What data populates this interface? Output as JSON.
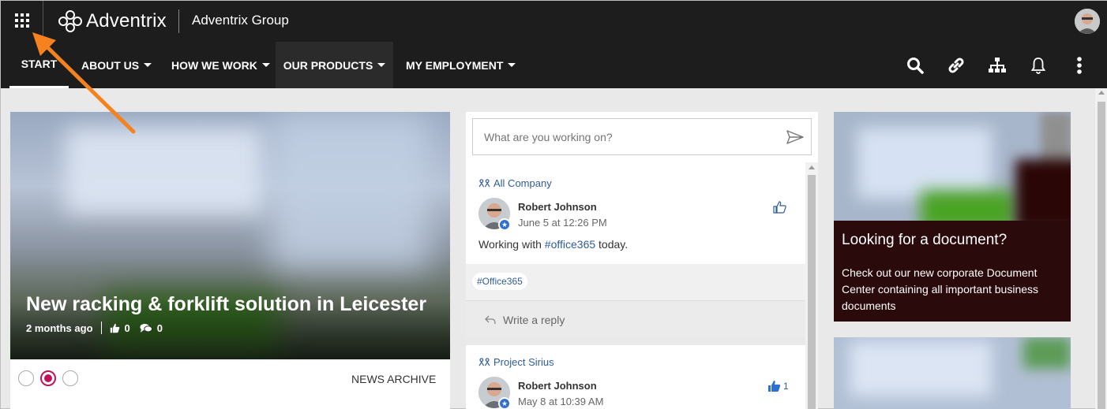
{
  "header": {
    "logo_text": "Adventrix",
    "site_title": "Adventrix Group"
  },
  "nav": {
    "items": [
      {
        "label": "START",
        "has_caret": false
      },
      {
        "label": "ABOUT US",
        "has_caret": true
      },
      {
        "label": "HOW WE WORK",
        "has_caret": true
      },
      {
        "label": "OUR PRODUCTS",
        "has_caret": true
      },
      {
        "label": "MY EMPLOYMENT",
        "has_caret": true
      }
    ],
    "icons": [
      "search-icon",
      "link-icon",
      "org-chart-icon",
      "bell-icon",
      "more-vertical-icon"
    ]
  },
  "news": {
    "title": "New racking & forklift solution in Leicester",
    "age": "2 months ago",
    "likes": "0",
    "comments": "0",
    "archive_label": "NEWS ARCHIVE",
    "slides": 3,
    "active_slide": 2
  },
  "feed": {
    "input_placeholder": "What are you working on?",
    "posts": [
      {
        "group": "All Company",
        "author": "Robert Johnson",
        "date": "June 5 at 12:26 PM",
        "text_before": "Working with ",
        "hashtag": "#office365",
        "text_after": " today.",
        "tag": "#Office365",
        "reply_placeholder": "Write a reply",
        "likes": ""
      },
      {
        "group": "Project Sirius",
        "author": "Robert Johnson",
        "date": "May 8 at 10:39 AM",
        "likes": "1"
      }
    ]
  },
  "document_card": {
    "title": "Looking for a document?",
    "description": "Check out our new corporate Document Center containing all important business documents"
  },
  "colors": {
    "header_bg": "#1d1d1d",
    "accent": "#c0135e",
    "link": "#2f5c99",
    "annotation_arrow": "#f5821f",
    "doc_card_bg": "#2a0a0a"
  }
}
